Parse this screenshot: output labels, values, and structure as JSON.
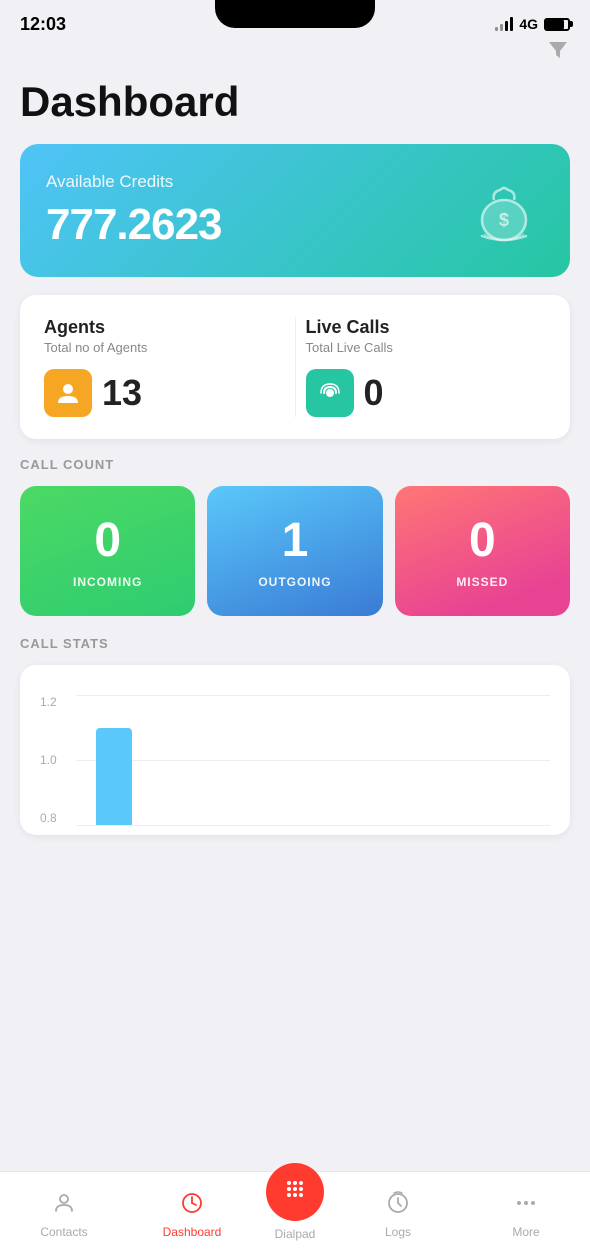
{
  "statusBar": {
    "time": "12:03",
    "network": "4G"
  },
  "header": {
    "title": "Dashboard",
    "filterIcon": "▼"
  },
  "creditsCard": {
    "label": "Available Credits",
    "value": "777.2623"
  },
  "agentsBlock": {
    "title": "Agents",
    "subtitle": "Total no of Agents",
    "count": "13"
  },
  "liveCallsBlock": {
    "title": "Live Calls",
    "subtitle": "Total Live Calls",
    "count": "0"
  },
  "callCount": {
    "sectionLabel": "CALL COUNT",
    "incoming": {
      "count": "0",
      "label": "INCOMING"
    },
    "outgoing": {
      "count": "1",
      "label": "OUTGOING"
    },
    "missed": {
      "count": "0",
      "label": "MISSED"
    }
  },
  "callStats": {
    "sectionLabel": "CALL STATS",
    "yLabels": [
      "1.2",
      "1.0",
      "0.8"
    ],
    "bars": [
      {
        "height": 80,
        "label": ""
      }
    ]
  },
  "bottomNav": {
    "contacts": "Contacts",
    "dashboard": "Dashboard",
    "dialpad": "Dialpad",
    "logs": "Logs",
    "more": "More"
  }
}
